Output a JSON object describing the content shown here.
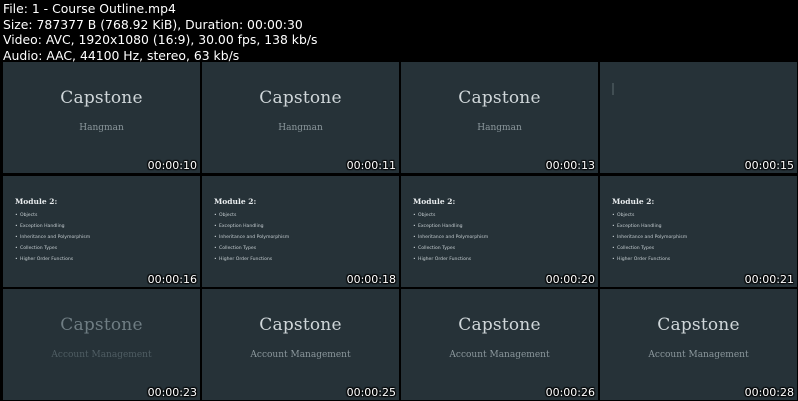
{
  "header": {
    "file": "File: 1 - Course Outline.mp4",
    "size": "Size: 787377 B (768.92 KiB), Duration: 00:00:30",
    "video": "Video: AVC, 1920x1080 (16:9), 30.00 fps, 138 kb/s",
    "audio": "Audio: AAC, 44100 Hz, stereo, 63 kb/s"
  },
  "thumbnails": [
    {
      "title": "Capstone",
      "subtitle": "Hangman",
      "timestamp": "00:00:10"
    },
    {
      "title": "Capstone",
      "subtitle": "Hangman",
      "timestamp": "00:00:11"
    },
    {
      "title": "Capstone",
      "subtitle": "Hangman",
      "timestamp": "00:00:13"
    },
    {
      "timestamp": "00:00:15"
    },
    {
      "timestamp": "00:00:16"
    },
    {
      "timestamp": "00:00:18"
    },
    {
      "timestamp": "00:00:20"
    },
    {
      "timestamp": "00:00:21"
    },
    {
      "title": "Capstone",
      "subtitle": "Account Management",
      "timestamp": "00:00:23"
    },
    {
      "title": "Capstone",
      "subtitle": "Account Management",
      "timestamp": "00:00:25"
    },
    {
      "title": "Capstone",
      "subtitle": "Account Management",
      "timestamp": "00:00:26"
    },
    {
      "title": "Capstone",
      "subtitle": "Account Management",
      "timestamp": "00:00:28"
    }
  ],
  "module": {
    "title": "Module 2:",
    "items": [
      "Objects",
      "Exception Handling",
      "Inheritance and Polymorphism",
      "Collection Types",
      "Higher Order Functions"
    ]
  }
}
